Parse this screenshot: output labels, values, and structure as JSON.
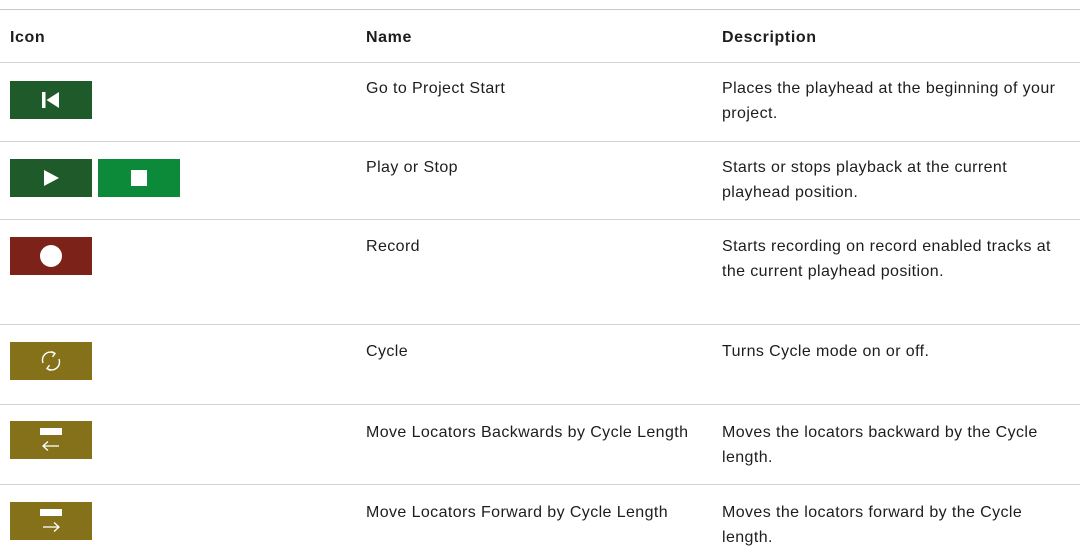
{
  "header": {
    "icon": "Icon",
    "name": "Name",
    "description": "Description"
  },
  "rows": [
    {
      "icons": [
        "skip-to-start-icon"
      ],
      "colors": [
        "#1f5a2a"
      ],
      "name": "Go to Project Start",
      "description": "Places the playhead at the beginning of your project."
    },
    {
      "icons": [
        "play-icon",
        "stop-icon"
      ],
      "colors": [
        "#1f5a2a",
        "#0c8a3a"
      ],
      "name": "Play or Stop",
      "description": "Starts or stops playback at the current playhead position."
    },
    {
      "icons": [
        "record-icon"
      ],
      "colors": [
        "#7c2218"
      ],
      "name": "Record",
      "description": "Starts recording on record enabled tracks at the current playhead position."
    },
    {
      "icons": [
        "cycle-icon"
      ],
      "colors": [
        "#84711a"
      ],
      "name": "Cycle",
      "description": "Turns Cycle mode on or off."
    },
    {
      "icons": [
        "move-locators-backward-icon"
      ],
      "colors": [
        "#84711a"
      ],
      "name": "Move Locators Backwards by Cycle Length",
      "description": "Moves the locators backward by the Cycle length."
    },
    {
      "icons": [
        "move-locators-forward-icon"
      ],
      "colors": [
        "#84711a"
      ],
      "name": "Move Locators Forward by Cycle Length",
      "description": "Moves the locators forward by the Cycle length."
    }
  ]
}
